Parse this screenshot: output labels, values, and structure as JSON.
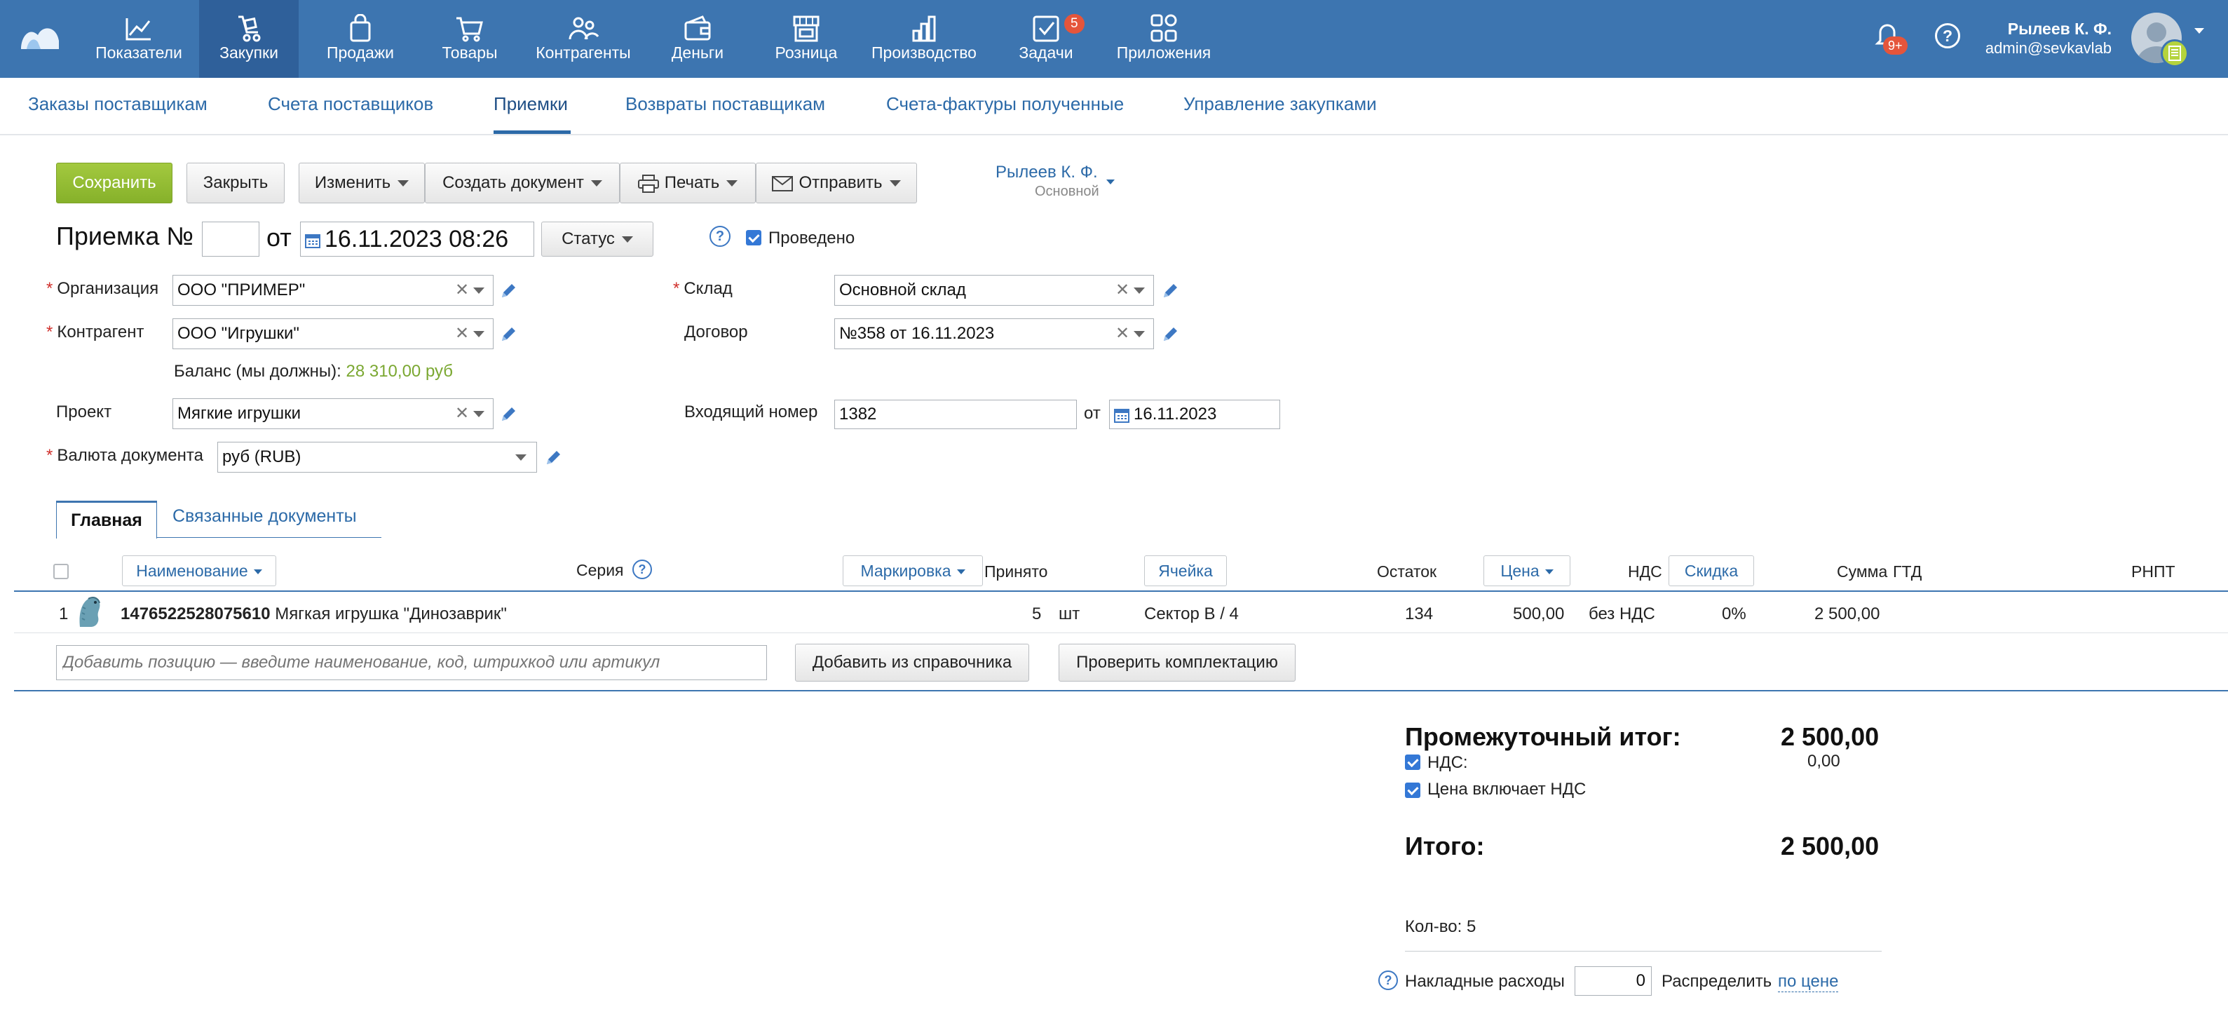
{
  "nav": {
    "items": [
      {
        "label": "Показатели",
        "icon": "chart-line-icon"
      },
      {
        "label": "Закупки",
        "icon": "purchase-icon"
      },
      {
        "label": "Продажи",
        "icon": "bag-icon"
      },
      {
        "label": "Товары",
        "icon": "cart-icon"
      },
      {
        "label": "Контрагенты",
        "icon": "people-icon"
      },
      {
        "label": "Деньги",
        "icon": "wallet-icon"
      },
      {
        "label": "Розница",
        "icon": "store-icon"
      },
      {
        "label": "Производство",
        "icon": "factory-icon"
      },
      {
        "label": "Задачи",
        "icon": "tasks-icon",
        "badge": "5"
      },
      {
        "label": "Приложения",
        "icon": "apps-icon"
      }
    ],
    "notifications_badge": "9+",
    "user_name": "Рылеев К. Ф.",
    "user_email": "admin@sevkavlab"
  },
  "subnav": {
    "tabs": [
      "Заказы поставщикам",
      "Счета поставщиков",
      "Приемки",
      "Возвраты поставщикам",
      "Счета-фактуры полученные",
      "Управление закупками"
    ],
    "active": "Приемки"
  },
  "toolbar": {
    "save": "Сохранить",
    "close": "Закрыть",
    "edit": "Изменить",
    "create_doc": "Создать документ",
    "print": "Печать",
    "send": "Отправить",
    "owner_name": "Рылеев К. Ф.",
    "owner_group": "Основной"
  },
  "doc": {
    "title": "Приемка №",
    "number": "",
    "from_label": "от",
    "datetime": "16.11.2023 08:26",
    "status_button": "Статус",
    "posted_label": "Проведено",
    "posted": true
  },
  "form": {
    "org_label": "Организация",
    "org_value": "ООО \"ПРИМЕР\"",
    "contractor_label": "Контрагент",
    "contractor_value": "ООО \"Игрушки\"",
    "balance_label": "Баланс (мы должны):",
    "balance_value": "28 310,00 руб",
    "project_label": "Проект",
    "project_value": "Мягкие игрушки",
    "currency_label": "Валюта документа",
    "currency_value": "руб (RUB)",
    "warehouse_label": "Склад",
    "warehouse_value": "Основной склад",
    "contract_label": "Договор",
    "contract_value": "№358 от 16.11.2023",
    "incoming_label": "Входящий номер",
    "incoming_value": "1382",
    "incoming_from_label": "от",
    "incoming_date": "16.11.2023"
  },
  "doc_tabs": {
    "main": "Главная",
    "related": "Связанные документы"
  },
  "table": {
    "headers": {
      "name": "Наименование",
      "series": "Серия",
      "marking": "Маркировка",
      "accepted": "Принято",
      "cell": "Ячейка",
      "remainder": "Остаток",
      "price": "Цена",
      "vat": "НДС",
      "discount": "Скидка",
      "sum": "Сумма",
      "gtd": "ГТД",
      "rnpt": "РНПТ"
    },
    "rows": [
      {
        "index": "1",
        "code": "1476522528075610",
        "name": "Мягкая игрушка \"Динозаврик\"",
        "qty": "5",
        "unit": "шт",
        "cell": "Сектор В / 4",
        "remainder": "134",
        "price": "500,00",
        "vat": "без НДС",
        "discount": "0%",
        "sum": "2 500,00"
      }
    ],
    "add_placeholder": "Добавить позицию — введите наименование, код, штрихкод или артикул",
    "add_from_catalog": "Добавить из справочника",
    "check_kit": "Проверить комплектацию"
  },
  "totals": {
    "subtotal_label": "Промежуточный итог:",
    "subtotal_value": "2 500,00",
    "vat_label": "НДС:",
    "vat_value": "0,00",
    "price_incl_vat_label": "Цена включает НДС",
    "total_label": "Итого:",
    "total_value": "2 500,00",
    "qty_label": "Кол-во: 5",
    "overhead_label": "Накладные расходы",
    "overhead_value": "0",
    "distribute_label": "Распределить",
    "distribute_link": "по цене"
  },
  "colors": {
    "nav_bg": "#3d75b0",
    "nav_active": "#2f609a",
    "link": "#2c6aa8",
    "save_green": "#8fb934",
    "balance_green": "#7ba832",
    "badge_red": "#e5553b"
  }
}
